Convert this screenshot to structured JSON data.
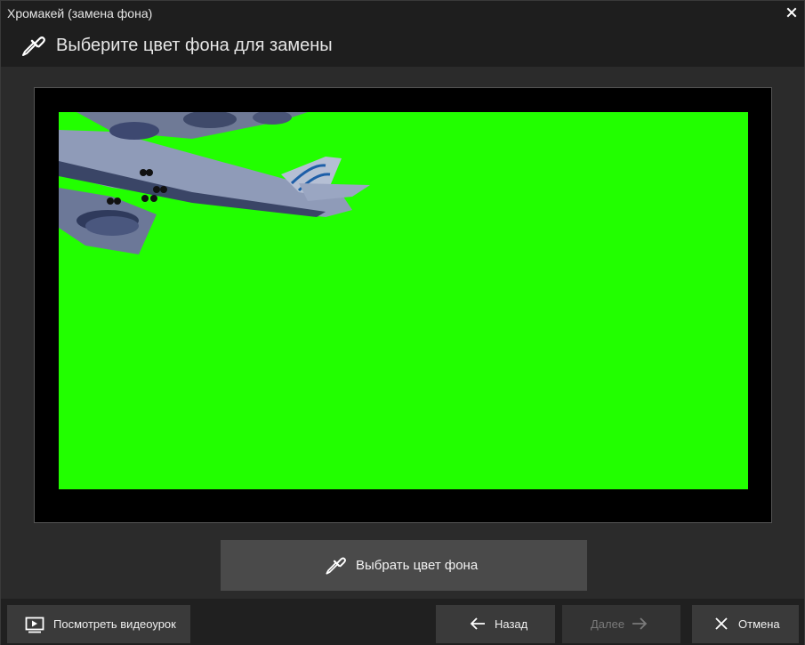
{
  "window": {
    "title": "Хромакей (замена фона)",
    "close_icon": "close-icon"
  },
  "header": {
    "icon": "eyedropper-icon",
    "heading": "Выберите цвет фона для замены"
  },
  "preview": {
    "background_color": "#22ff00",
    "content": "airplane-over-green-screen"
  },
  "pick_color_button": {
    "icon": "eyedropper-icon",
    "label": "Выбрать цвет фона"
  },
  "footer": {
    "tutorial_button": {
      "icon": "video-play-icon",
      "label": "Посмотреть видеоурок"
    },
    "back_button": {
      "icon": "arrow-left-icon",
      "label": "Назад"
    },
    "next_button": {
      "icon": "arrow-right-icon",
      "label": "Далее",
      "enabled": false
    },
    "cancel_button": {
      "icon": "close-icon",
      "label": "Отмена"
    }
  },
  "colors": {
    "title_bg": "#1e1e1e",
    "panel_bg": "#2b2b2b",
    "button_bg": "#4a4a4a",
    "chroma_green": "#22ff00"
  }
}
